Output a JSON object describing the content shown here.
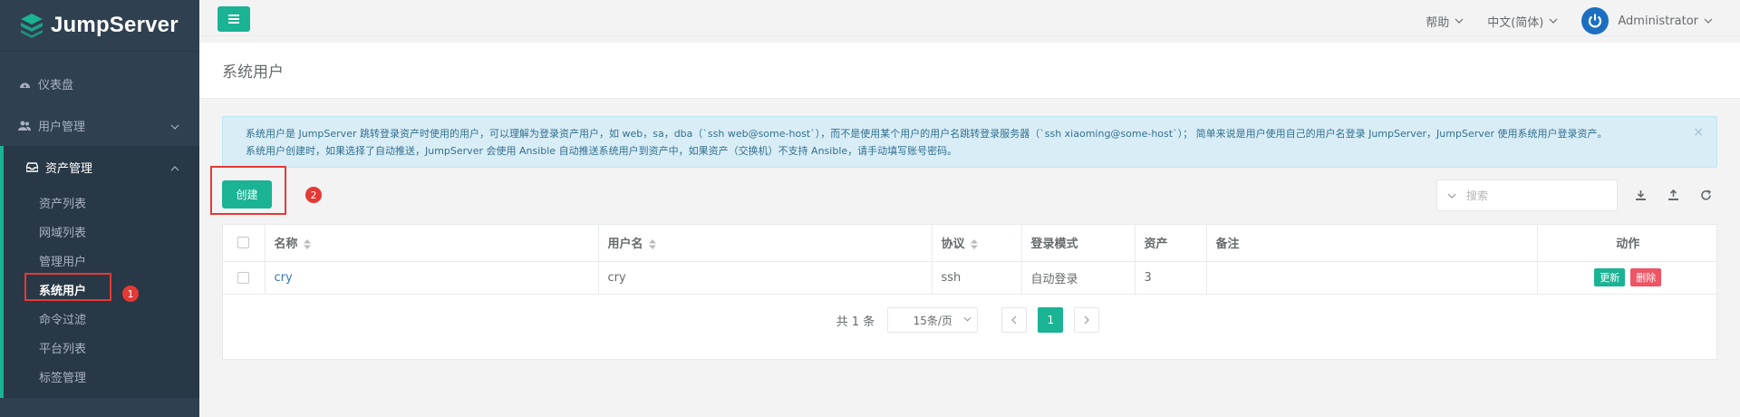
{
  "app": {
    "logo_text": "JumpServer"
  },
  "sidebar": {
    "items": [
      {
        "label": "仪表盘",
        "icon": "dashboard-icon"
      },
      {
        "label": "用户管理",
        "icon": "users-icon"
      },
      {
        "label": "资产管理",
        "icon": "inbox-icon"
      }
    ],
    "asset_sub": [
      {
        "label": "资产列表"
      },
      {
        "label": "网域列表"
      },
      {
        "label": "管理用户"
      },
      {
        "label": "系统用户",
        "active": true
      },
      {
        "label": "命令过滤"
      },
      {
        "label": "平台列表"
      },
      {
        "label": "标签管理"
      }
    ]
  },
  "topbar": {
    "help": "帮助",
    "language": "中文(简体)",
    "user": "Administrator"
  },
  "page": {
    "title": "系统用户"
  },
  "alert": {
    "line1": "系统用户是 JumpServer 跳转登录资产时使用的用户，可以理解为登录资产用户，如 web，sa，dba（`ssh web@some-host`），而不是使用某个用户的用户名跳转登录服务器（`ssh xiaoming@some-host`）； 简单来说是用户使用自己的用户名登录 JumpServer，JumpServer 使用系统用户登录资产。",
    "line2": "系统用户创建时，如果选择了自动推送，JumpServer 会使用 Ansible 自动推送系统用户到资产中，如果资产（交换机）不支持 Ansible，请手动填写账号密码。",
    "close": "×"
  },
  "toolbar": {
    "create_label": "创建",
    "search_placeholder": "搜索"
  },
  "annotations": {
    "badge1": "1",
    "badge2": "2"
  },
  "table": {
    "headers": [
      "名称",
      "用户名",
      "协议",
      "登录模式",
      "资产",
      "备注",
      "动作"
    ],
    "rows": [
      {
        "name": "cry",
        "username": "cry",
        "protocol": "ssh",
        "login_mode": "自动登录",
        "assets": "3",
        "comment": ""
      }
    ],
    "update_label": "更新",
    "delete_label": "删除"
  },
  "pagination": {
    "total": "共 1 条",
    "page_size": "15条/页",
    "current_page": "1"
  },
  "colors": {
    "accent": "#1ab394",
    "sidebar": "#2f4050",
    "danger": "#ed5565",
    "annotation": "#e53935"
  }
}
